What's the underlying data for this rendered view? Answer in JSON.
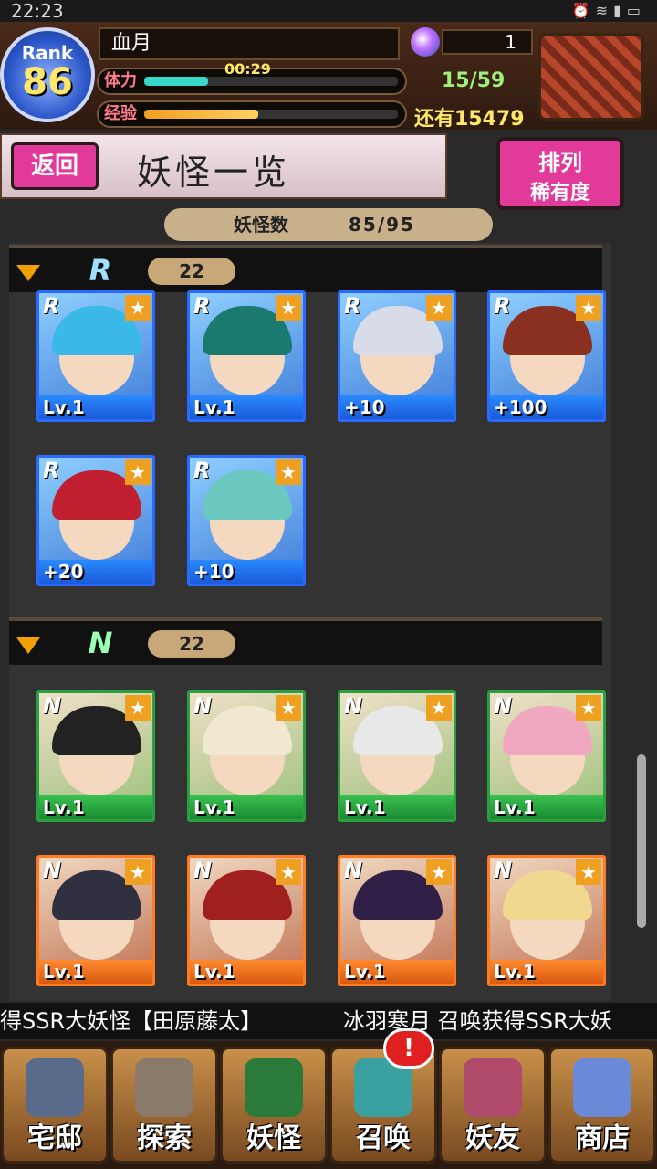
{
  "status_bar": {
    "time": "22:23",
    "icons": [
      "alarm-icon",
      "wifi-icon",
      "signal-icon",
      "battery-icon"
    ]
  },
  "player": {
    "rank_label": "Rank",
    "rank_value": "86",
    "name": "血月",
    "gems": "1",
    "stamina_label": "体力",
    "stamina_timer": "00:29",
    "stamina_value": "15/59",
    "stamina_fraction": 0.25,
    "exp_label": "经验",
    "exp_fraction": 0.45,
    "exp_remaining": "还有15479"
  },
  "header": {
    "back_label": "返回",
    "title": "妖怪一览",
    "sort_label_1": "排列",
    "sort_label_2": "稀有度"
  },
  "count_bar": {
    "label": "妖怪数",
    "value": "85/95"
  },
  "sections": [
    {
      "rarity": "R",
      "count": "22",
      "cards": [
        {
          "rarity": "R",
          "level": "Lv.1",
          "hair": "#3ab8e8"
        },
        {
          "rarity": "R",
          "level": "Lv.1",
          "hair": "#1a7a70"
        },
        {
          "rarity": "R",
          "level": "+10",
          "hair": "#d8dce8"
        },
        {
          "rarity": "R",
          "level": "+100",
          "hair": "#8a3020"
        },
        {
          "rarity": "R",
          "level": "+20",
          "hair": "#c02030"
        },
        {
          "rarity": "R",
          "level": "+10",
          "hair": "#6ac8c0"
        }
      ]
    },
    {
      "rarity": "N",
      "count": "22",
      "cards": [
        {
          "rarity": "N",
          "level": "Lv.1",
          "hair": "#222222",
          "frame": "green"
        },
        {
          "rarity": "N",
          "level": "Lv.1",
          "hair": "#f0e8d0",
          "frame": "green"
        },
        {
          "rarity": "N",
          "level": "Lv.1",
          "hair": "#e8e8e8",
          "frame": "green"
        },
        {
          "rarity": "N",
          "level": "Lv.1",
          "hair": "#f0a8c0",
          "frame": "green"
        },
        {
          "rarity": "N",
          "level": "Lv.1",
          "hair": "#303040",
          "frame": "orange"
        },
        {
          "rarity": "N",
          "level": "Lv.1",
          "hair": "#a02020",
          "frame": "orange"
        },
        {
          "rarity": "N",
          "level": "Lv.1",
          "hair": "#302048",
          "frame": "orange"
        },
        {
          "rarity": "N",
          "level": "Lv.1",
          "hair": "#f0d890",
          "frame": "orange"
        }
      ]
    }
  ],
  "ticker": {
    "left": "得SSR大妖怪【田原藤太】",
    "right": "冰羽寒月 召唤获得SSR大妖"
  },
  "nav": [
    {
      "label": "宅邸",
      "icon": "mansion-icon"
    },
    {
      "label": "探索",
      "icon": "magnifier-icon"
    },
    {
      "label": "妖怪",
      "icon": "scroll-icon"
    },
    {
      "label": "召唤",
      "icon": "pentagram-icon"
    },
    {
      "label": "妖友",
      "icon": "friend-icon"
    },
    {
      "label": "商店",
      "icon": "crystal-ball-icon"
    }
  ],
  "notification": "!"
}
